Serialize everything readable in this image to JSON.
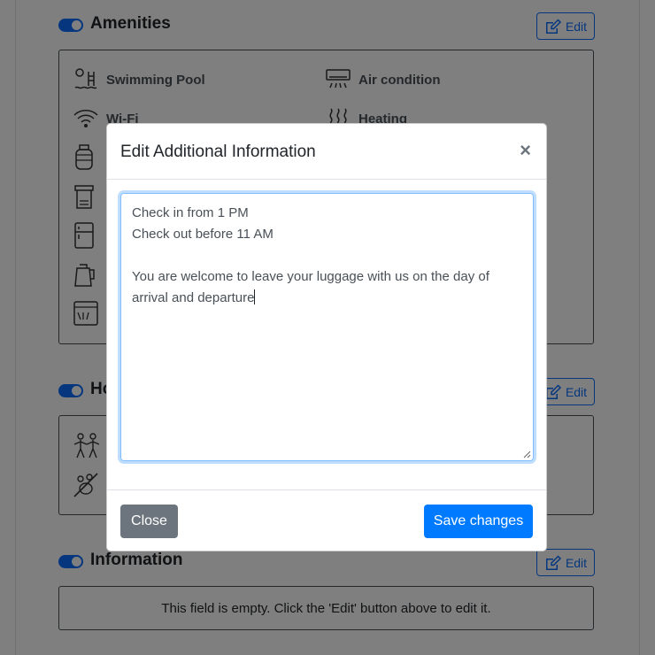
{
  "sections": {
    "amenities": {
      "title": "Amenities",
      "edit_label": "Edit"
    },
    "house_rules": {
      "title": "House rules",
      "edit_label": "Edit"
    },
    "information": {
      "title": "Information",
      "edit_label": "Edit",
      "empty_text": "This field is empty. Click the 'Edit' button above to edit it."
    }
  },
  "amenities": [
    {
      "label": "Swimming Pool",
      "icon": "swimming-pool-icon"
    },
    {
      "label": "Air condition",
      "icon": "air-conditioner-icon"
    },
    {
      "label": "Wi-Fi",
      "icon": "wifi-icon"
    },
    {
      "label": "Heating",
      "icon": "heating-icon"
    }
  ],
  "modal": {
    "title": "Edit Additional Information",
    "close_symbol": "×",
    "text": "Check in from 1 PM\nCheck out before 11 AM\n\nYou are welcome to leave your luggage with us on the day of arrival and departure",
    "close_label": "Close",
    "save_label": "Save changes"
  },
  "colors": {
    "primary": "#007bff",
    "outline": "#0d6efd",
    "secondary": "#6c757d",
    "backdrop": "rgba(0,0,0,0.5)"
  }
}
